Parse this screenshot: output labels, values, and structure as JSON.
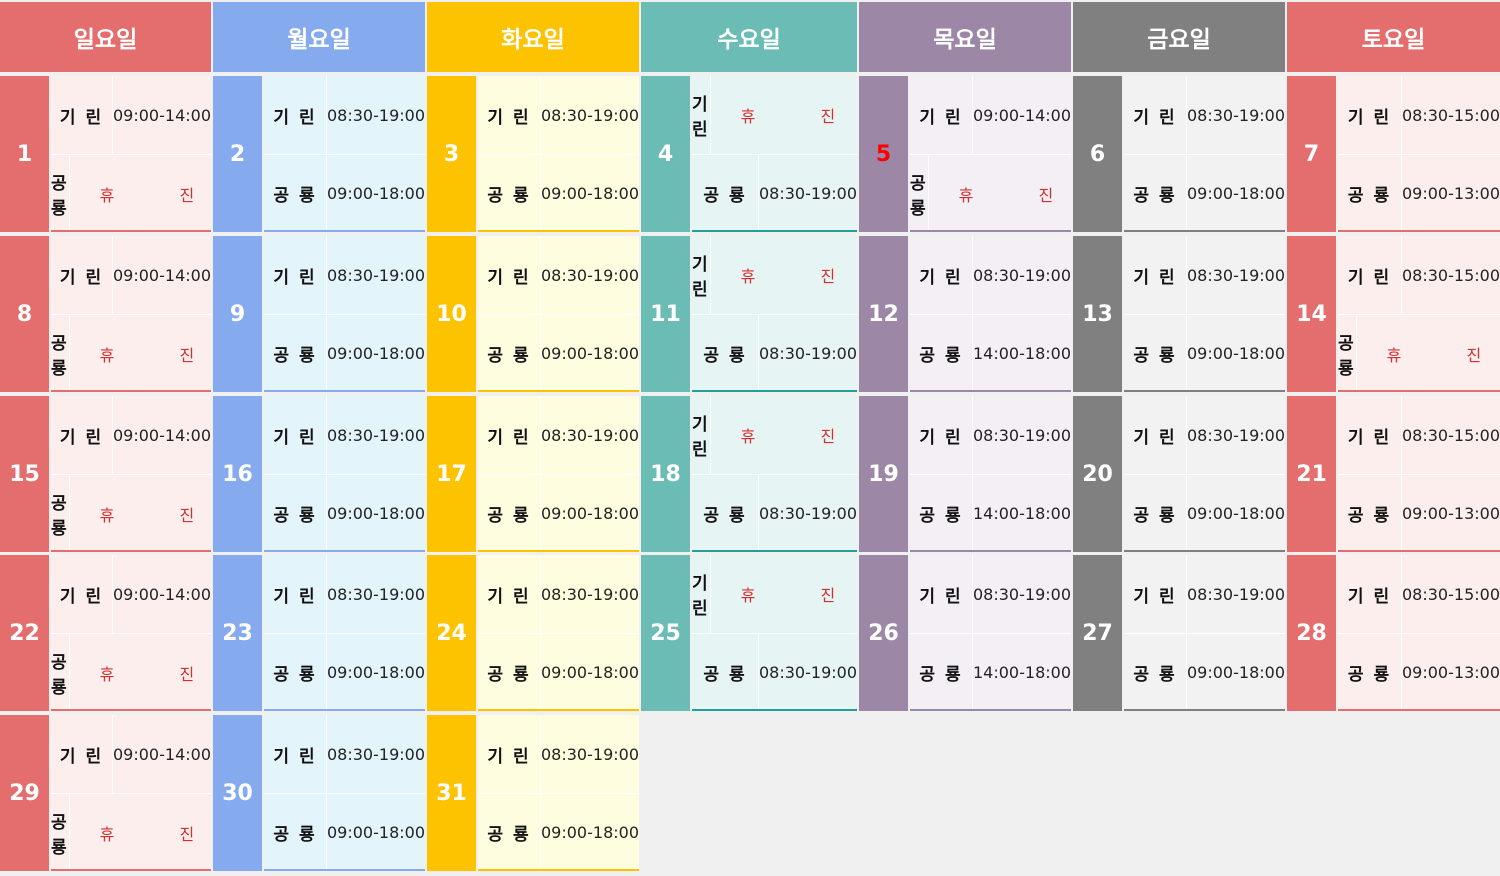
{
  "title": "",
  "colors": {
    "sun": {
      "head": "#e46d6e",
      "bg": "#fdeeee",
      "line": "#e46d6e"
    },
    "mon": {
      "head": "#86aaee",
      "bg": "#e3f4fb",
      "line": "#86aaee"
    },
    "tue": {
      "head": "#fec300",
      "bg": "#fefde0",
      "line": "#fec300"
    },
    "wed": {
      "head": "#6abcb5",
      "bg": "#e6f5f3",
      "line": "#20a09a"
    },
    "thu": {
      "head": "#9c88a6",
      "bg": "#f3eff5",
      "line": "#9c88a6"
    },
    "fri": {
      "head": "#808080",
      "bg": "#f2f2f2",
      "line": "#808080"
    },
    "sat": {
      "head": "#e46d6e",
      "bg": "#fdeeee",
      "line": "#e46d6e"
    },
    "closed_text": "#d03030",
    "holiday_num": "#ff0000"
  },
  "weekdays": [
    "일요일",
    "월요일",
    "화요일",
    "수요일",
    "목요일",
    "금요일",
    "토요일"
  ],
  "labels": {
    "row1": "기 린",
    "row2": "공 룡"
  },
  "closed_text": "휴 진",
  "weeks": [
    [
      {
        "day": "1",
        "r1": "09:00-14:00",
        "r2": "휴 진"
      },
      {
        "day": "2",
        "r1": "08:30-19:00",
        "r2": "09:00-18:00"
      },
      {
        "day": "3",
        "r1": "08:30-19:00",
        "r2": "09:00-18:00"
      },
      {
        "day": "4",
        "r1": "휴 진",
        "r2": "08:30-19:00"
      },
      {
        "day": "5",
        "r1": "09:00-14:00",
        "r2": "휴 진",
        "holiday": true
      },
      {
        "day": "6",
        "r1": "08:30-19:00",
        "r2": "09:00-18:00"
      },
      {
        "day": "7",
        "r1": "08:30-15:00",
        "r2": "09:00-13:00"
      }
    ],
    [
      {
        "day": "8",
        "r1": "09:00-14:00",
        "r2": "휴 진"
      },
      {
        "day": "9",
        "r1": "08:30-19:00",
        "r2": "09:00-18:00"
      },
      {
        "day": "10",
        "r1": "08:30-19:00",
        "r2": "09:00-18:00"
      },
      {
        "day": "11",
        "r1": "휴 진",
        "r2": "08:30-19:00"
      },
      {
        "day": "12",
        "r1": "08:30-19:00",
        "r2": "14:00-18:00"
      },
      {
        "day": "13",
        "r1": "08:30-19:00",
        "r2": "09:00-18:00"
      },
      {
        "day": "14",
        "r1": "08:30-15:00",
        "r2": "휴 진"
      }
    ],
    [
      {
        "day": "15",
        "r1": "09:00-14:00",
        "r2": "휴 진"
      },
      {
        "day": "16",
        "r1": "08:30-19:00",
        "r2": "09:00-18:00"
      },
      {
        "day": "17",
        "r1": "08:30-19:00",
        "r2": "09:00-18:00"
      },
      {
        "day": "18",
        "r1": "휴 진",
        "r2": "08:30-19:00"
      },
      {
        "day": "19",
        "r1": "08:30-19:00",
        "r2": "14:00-18:00"
      },
      {
        "day": "20",
        "r1": "08:30-19:00",
        "r2": "09:00-18:00"
      },
      {
        "day": "21",
        "r1": "08:30-15:00",
        "r2": "09:00-13:00"
      }
    ],
    [
      {
        "day": "22",
        "r1": "09:00-14:00",
        "r2": "휴 진"
      },
      {
        "day": "23",
        "r1": "08:30-19:00",
        "r2": "09:00-18:00"
      },
      {
        "day": "24",
        "r1": "08:30-19:00",
        "r2": "09:00-18:00"
      },
      {
        "day": "25",
        "r1": "휴 진",
        "r2": "08:30-19:00"
      },
      {
        "day": "26",
        "r1": "08:30-19:00",
        "r2": "14:00-18:00"
      },
      {
        "day": "27",
        "r1": "08:30-19:00",
        "r2": "09:00-18:00"
      },
      {
        "day": "28",
        "r1": "08:30-15:00",
        "r2": "09:00-13:00"
      }
    ],
    [
      {
        "day": "29",
        "r1": "09:00-14:00",
        "r2": "휴 진"
      },
      {
        "day": "30",
        "r1": "08:30-19:00",
        "r2": "09:00-18:00"
      },
      {
        "day": "31",
        "r1": "08:30-19:00",
        "r2": "09:00-18:00"
      },
      null,
      null,
      null,
      null
    ]
  ]
}
